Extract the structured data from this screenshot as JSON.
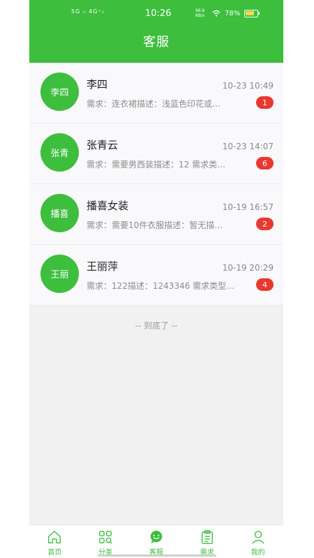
{
  "status": {
    "signal": "5G ᵢₗ 4G⁺ᵢₗ",
    "time": "10:26",
    "net_speed": "96.6 KB/s",
    "battery": "78%"
  },
  "header": {
    "title": "客服"
  },
  "conversations": [
    {
      "avatar": "李四",
      "name": "李四",
      "time": "10-23 10:49",
      "desc": "需求：连衣裙描述：浅蓝色印花或…",
      "badge": "1"
    },
    {
      "avatar": "张青",
      "name": "张青云",
      "time": "10-23 14:07",
      "desc": "需求：需要男西装描述：12 需求类…",
      "badge": "6"
    },
    {
      "avatar": "播喜",
      "name": "播喜女装",
      "time": "10-19 16:57",
      "desc": "需求：需要10件衣服描述：暂无描…",
      "badge": "2"
    },
    {
      "avatar": "王丽",
      "name": "王丽萍",
      "time": "10-19 20:29",
      "desc": "需求：122描述：1243346 需求类型…",
      "badge": "4"
    }
  ],
  "list_end": "-- 到底了 --",
  "tabs": [
    {
      "label": "首页",
      "icon": "home-icon"
    },
    {
      "label": "分类",
      "icon": "category-icon"
    },
    {
      "label": "客服",
      "icon": "chat-icon"
    },
    {
      "label": "需求",
      "icon": "clipboard-icon"
    },
    {
      "label": "我的",
      "icon": "user-icon"
    }
  ],
  "colors": {
    "primary": "#3dbe3d",
    "badge": "#e8382f"
  }
}
